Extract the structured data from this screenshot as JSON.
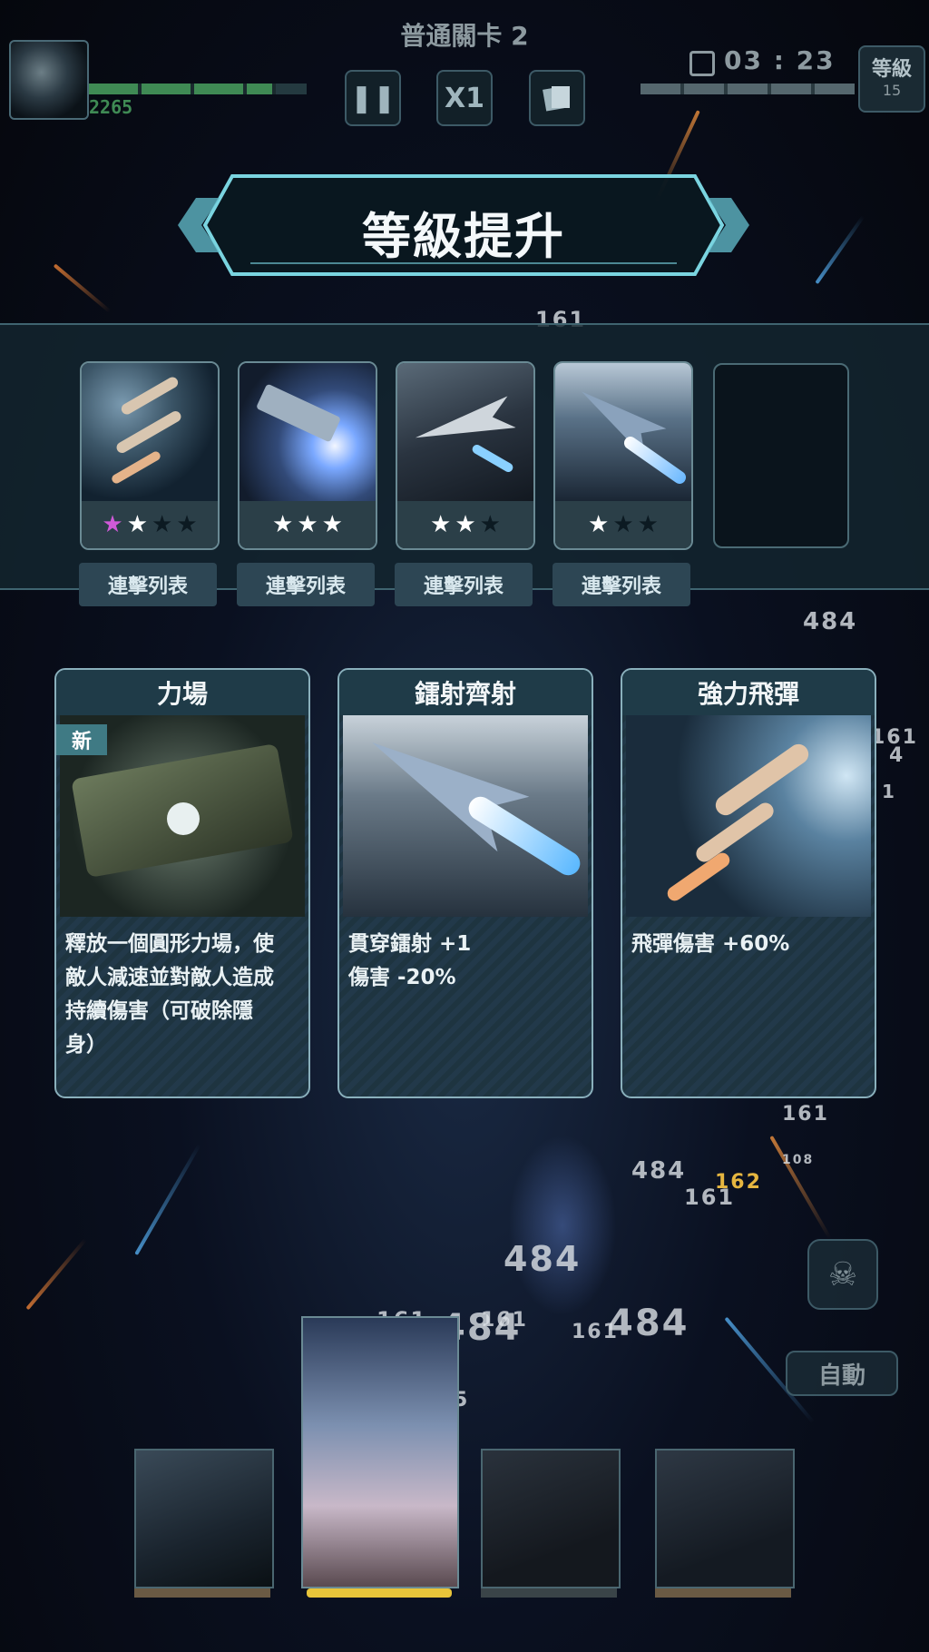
{
  "hud": {
    "stage_title": "普通關卡 2",
    "score": "2265",
    "timer": "03 : 23",
    "level_label": "等級",
    "level_value": "15",
    "speed_label": "X1"
  },
  "banner": {
    "title": "等級提升"
  },
  "equipped": {
    "combo_label": "連擊列表",
    "slots": [
      {
        "name": "missile-slot",
        "stars_filled": 2,
        "stars_total": 4,
        "first_star_color": "#d05ad8"
      },
      {
        "name": "plasma-slot",
        "stars_filled": 3,
        "stars_total": 3
      },
      {
        "name": "fighter-slot",
        "stars_filled": 2,
        "stars_total": 3
      },
      {
        "name": "laser-slot",
        "stars_filled": 1,
        "stars_total": 3
      }
    ]
  },
  "choices": [
    {
      "title": "力場",
      "is_new": true,
      "new_label": "新",
      "description": "釋放一個圓形力場，使\n敵人減速並對敵人造成\n持續傷害（可破除隱\n身）"
    },
    {
      "title": "鐳射齊射",
      "is_new": false,
      "new_label": "",
      "description": "貫穿鐳射 +1\n傷害 -20%"
    },
    {
      "title": "強力飛彈",
      "is_new": false,
      "new_label": "",
      "description": "飛彈傷害 +60%"
    }
  ],
  "auto_button": "自動",
  "damage_numbers": [
    "161",
    "484",
    "484",
    "161",
    "162",
    "108",
    "161",
    "161",
    "484",
    "161",
    "161",
    "484",
    "484",
    "5",
    "161",
    "161",
    "4",
    "1"
  ],
  "colors": {
    "accent": "#7ad4e0",
    "gold": "#e8c43a",
    "hp_green": "#3f8a54"
  }
}
